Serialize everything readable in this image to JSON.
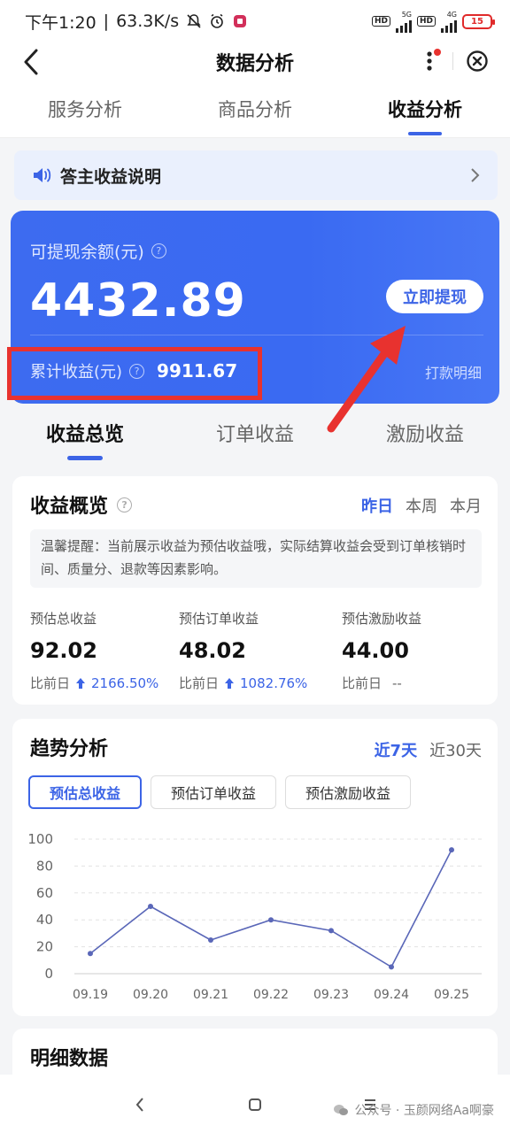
{
  "status_bar": {
    "time": "下午1:20",
    "speed": "63.3K/s",
    "hd1": "HD",
    "net1": "5G",
    "hd2": "HD",
    "net2": "4G",
    "battery": "15"
  },
  "header": {
    "title": "数据分析"
  },
  "main_tabs": [
    {
      "label": "服务分析"
    },
    {
      "label": "商品分析"
    },
    {
      "label": "收益分析",
      "active": true
    }
  ],
  "notice": {
    "text": "答主收益说明"
  },
  "balance": {
    "label": "可提现余额(元)",
    "amount": "4432.89",
    "withdraw_button": "立即提现",
    "cumulative_label": "累计收益(元)",
    "cumulative_value": "9911.67",
    "detail_link": "打款明细"
  },
  "sub_tabs": [
    {
      "label": "收益总览",
      "active": true
    },
    {
      "label": "订单收益"
    },
    {
      "label": "激励收益"
    }
  ],
  "overview": {
    "title": "收益概览",
    "periods": [
      "昨日",
      "本周",
      "本月"
    ],
    "tip": "温馨提醒：当前展示收益为预估收益哦，实际结算收益会受到订单核销时间、质量分、退款等因素影响。",
    "stats": [
      {
        "label": "预估总收益",
        "value": "92.02",
        "compare_label": "比前日",
        "change": "2166.50%",
        "trend": "up"
      },
      {
        "label": "预估订单收益",
        "value": "48.02",
        "compare_label": "比前日",
        "change": "1082.76%",
        "trend": "up"
      },
      {
        "label": "预估激励收益",
        "value": "44.00",
        "compare_label": "比前日",
        "change": "--",
        "trend": "none"
      }
    ]
  },
  "trend": {
    "title": "趋势分析",
    "periods": [
      "近7天",
      "近30天"
    ],
    "metrics": [
      "预估总收益",
      "预估订单收益",
      "预估激励收益"
    ]
  },
  "chart_data": {
    "type": "line",
    "x": [
      "09.19",
      "09.20",
      "09.21",
      "09.22",
      "09.23",
      "09.24",
      "09.25"
    ],
    "series": [
      {
        "values": [
          15,
          50,
          25,
          40,
          32,
          5,
          92
        ]
      }
    ],
    "yticks": [
      0,
      20,
      40,
      60,
      80,
      100
    ],
    "ylim": [
      0,
      100
    ],
    "grid": true,
    "color": "#5a67b8"
  },
  "detail": {
    "title": "明细数据"
  },
  "watermark": "公众号 · 玉颜网络Aa啊豪",
  "colors": {
    "accent": "#3c64e6",
    "annotation": "#e8322f"
  }
}
